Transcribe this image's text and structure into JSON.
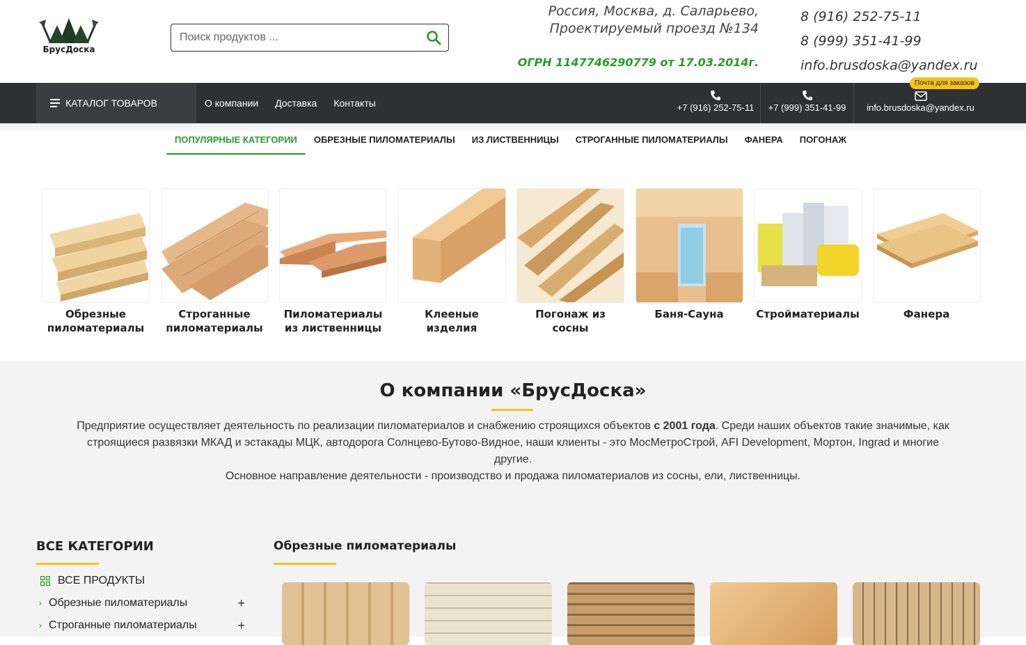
{
  "header": {
    "logo_text": "БрусДоска",
    "search_placeholder": "Поиск продуктов ...",
    "address_line1": "Россия, Москва, д. Саларьево,",
    "address_line2": "Проектируемый проезд №134",
    "ogrn": "ОГРН 1147746290779 от 17.03.2014г.",
    "phone1": "8 (916) 252-75-11",
    "phone2": "8 (999) 351-41-99",
    "email": "info.brusdoska@yandex.ru"
  },
  "nav": {
    "catalog_label": "КАТАЛОГ ТОВАРОВ",
    "links": [
      "О компании",
      "Доставка",
      "Контакты"
    ],
    "phone1": "+7 (916) 252-75-11",
    "phone2": "+7 (999) 351-41-99",
    "email": "info.brusdoska@yandex.ru",
    "order_badge": "Почта для заказов"
  },
  "tabs": [
    "ПОПУЛЯРНЫЕ КАТЕГОРИИ",
    "ОБРЕЗНЫЕ ПИЛОМАТЕРИАЛЫ",
    "ИЗ ЛИСТВЕННИЦЫ",
    "СТРОГАННЫЕ ПИЛОМАТЕРИАЛЫ",
    "ФАНЕРА",
    "ПОГОНАЖ"
  ],
  "tiles": [
    {
      "line1": "Обрезные",
      "line2": "пиломатериалы"
    },
    {
      "line1": "Строганные",
      "line2": "пиломатериалы"
    },
    {
      "line1": "Пиломатериалы",
      "line2": "из лиственницы"
    },
    {
      "line1": "Клееные",
      "line2": "изделия"
    },
    {
      "line1": "Погонаж из",
      "line2": "сосны"
    },
    {
      "line1": "Баня-Сауна",
      "line2": ""
    },
    {
      "line1": "Стройматериалы",
      "line2": ""
    },
    {
      "line1": "Фанера",
      "line2": ""
    }
  ],
  "about": {
    "title": "О компании «БрусДоска»",
    "p1_a": "Предприятие осуществляет деятельность по реализации пиломатериалов и снабжению строящихся объектов ",
    "p1_b": "с 2001 года",
    "p1_c": ". Среди наших объектов такие значимые, как строящиеся развязки МКАД и эстакады МЦК, автодорога Солнцево-Бутово-Видное, наши клиенты - это МосМетроСтрой, AFI Development, Мортон, Ingrad и многие другие.",
    "p2": "Основное направление деятельности - производство и продажа пиломатериалов из сосны, ели, лиственницы."
  },
  "sidebar": {
    "title": "ВСЕ КАТЕГОРИИ",
    "all_label": "ВСЕ ПРОДУКТЫ",
    "items": [
      "Обрезные пиломатериалы",
      "Строганные пиломатериалы"
    ]
  },
  "products": {
    "title": "Обрезные пиломатериалы"
  }
}
